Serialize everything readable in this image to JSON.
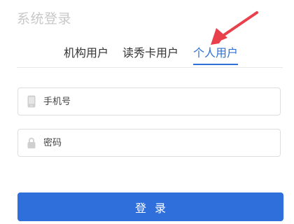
{
  "page": {
    "title": "系统登录"
  },
  "tabs": [
    {
      "label": "机构用户",
      "active": false
    },
    {
      "label": "读秀卡用户",
      "active": false
    },
    {
      "label": "个人用户",
      "active": true
    }
  ],
  "form": {
    "phone": {
      "placeholder": "手机号",
      "value": "",
      "icon": "phone-icon"
    },
    "password": {
      "placeholder": "密码",
      "value": "",
      "icon": "lock-icon"
    },
    "submit_label": "登录"
  },
  "colors": {
    "accent": "#2f6fd6",
    "button": "#2f6fdb",
    "annotation_arrow": "#e8414c",
    "title_text": "#c8c8c8"
  }
}
